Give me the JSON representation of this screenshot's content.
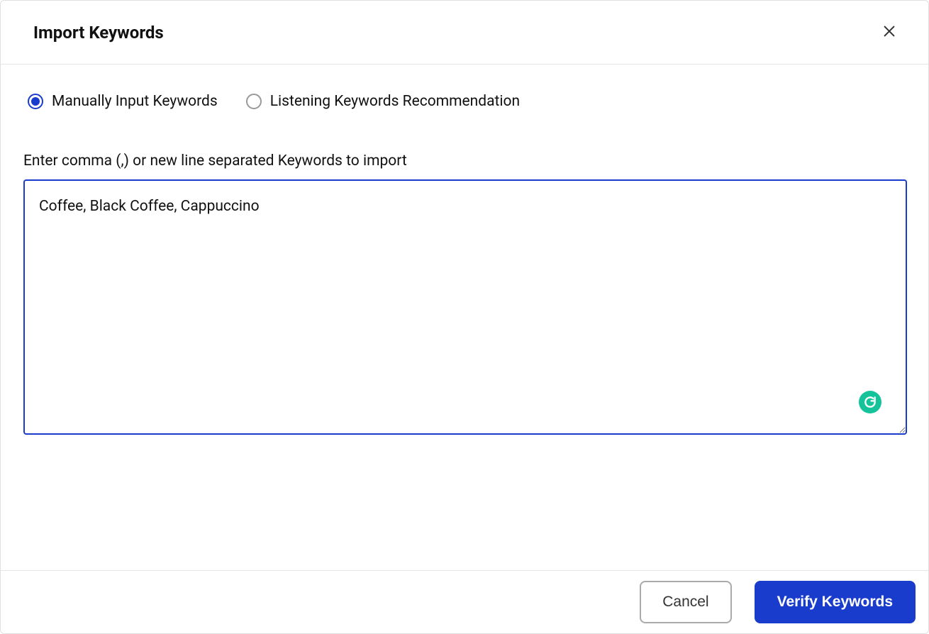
{
  "header": {
    "title": "Import Keywords"
  },
  "options": {
    "manual": {
      "label": "Manually Input Keywords",
      "selected": true
    },
    "recommendation": {
      "label": "Listening Keywords Recommendation",
      "selected": false
    }
  },
  "field": {
    "label": "Enter comma (,) or new line separated Keywords to import",
    "value": "Coffee, Black Coffee, Cappuccino"
  },
  "footer": {
    "cancel_label": "Cancel",
    "verify_label": "Verify Keywords"
  }
}
